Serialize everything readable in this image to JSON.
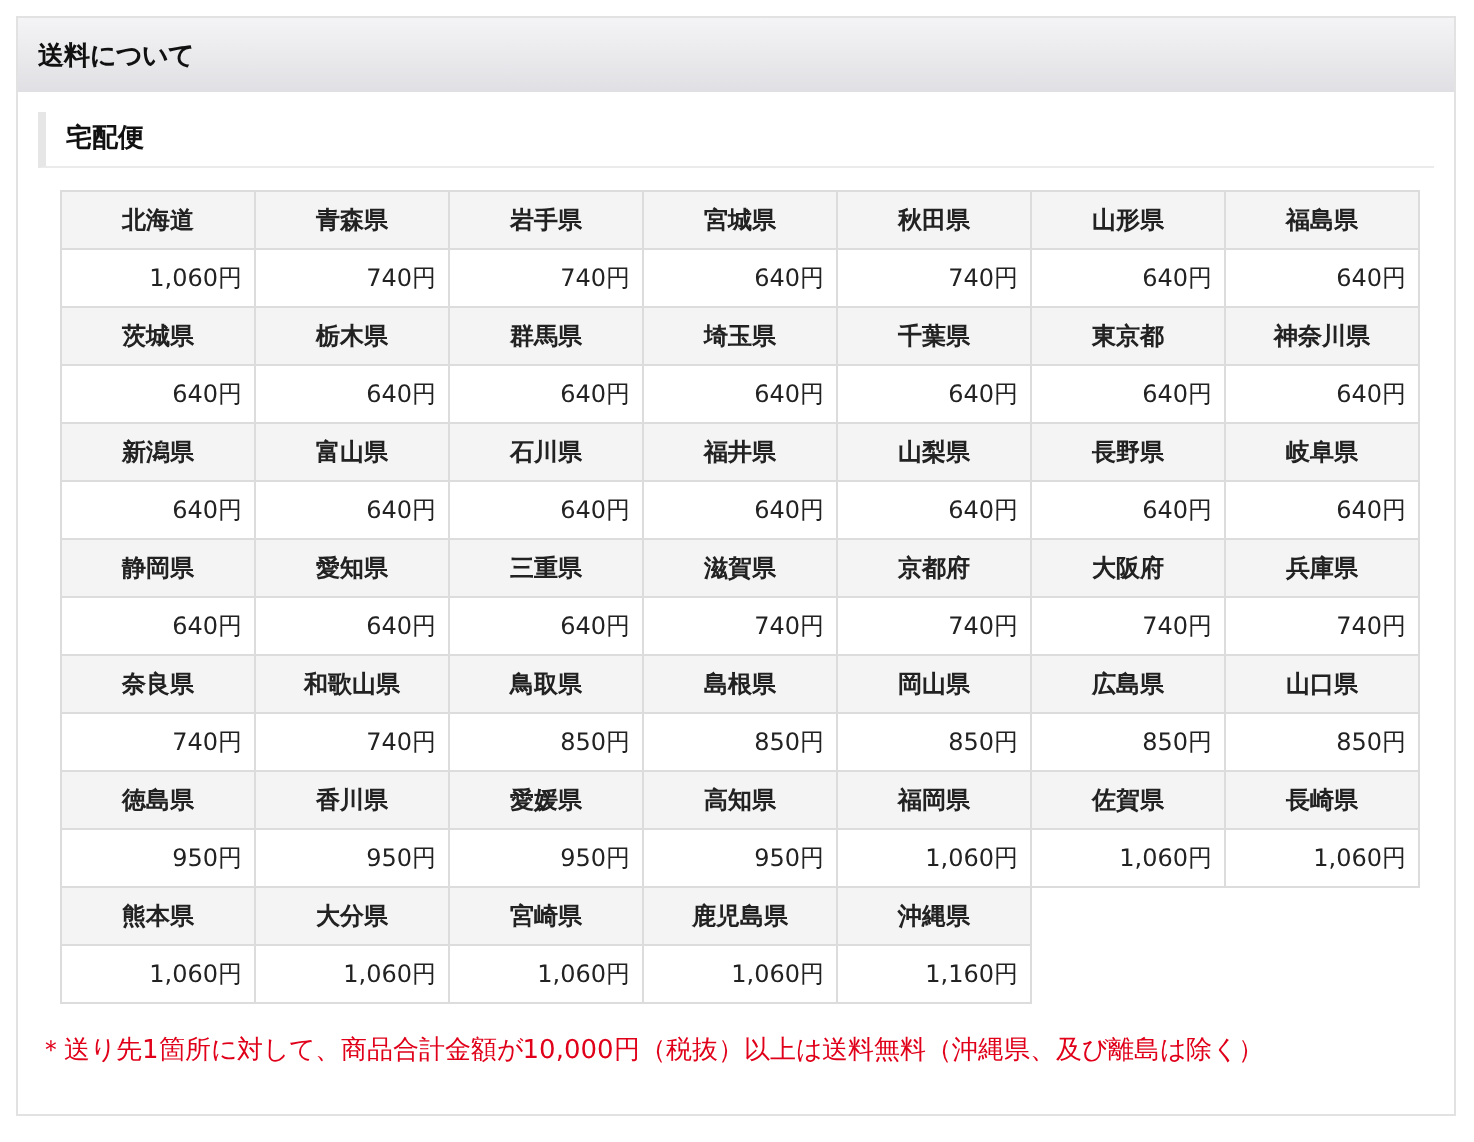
{
  "panel": {
    "title": "送料について",
    "subtitle": "宅配便"
  },
  "rates": [
    [
      {
        "region": "北海道",
        "price": "1,060円"
      },
      {
        "region": "青森県",
        "price": "740円"
      },
      {
        "region": "岩手県",
        "price": "740円"
      },
      {
        "region": "宮城県",
        "price": "640円"
      },
      {
        "region": "秋田県",
        "price": "740円"
      },
      {
        "region": "山形県",
        "price": "640円"
      },
      {
        "region": "福島県",
        "price": "640円"
      }
    ],
    [
      {
        "region": "茨城県",
        "price": "640円"
      },
      {
        "region": "栃木県",
        "price": "640円"
      },
      {
        "region": "群馬県",
        "price": "640円"
      },
      {
        "region": "埼玉県",
        "price": "640円"
      },
      {
        "region": "千葉県",
        "price": "640円"
      },
      {
        "region": "東京都",
        "price": "640円"
      },
      {
        "region": "神奈川県",
        "price": "640円"
      }
    ],
    [
      {
        "region": "新潟県",
        "price": "640円"
      },
      {
        "region": "富山県",
        "price": "640円"
      },
      {
        "region": "石川県",
        "price": "640円"
      },
      {
        "region": "福井県",
        "price": "640円"
      },
      {
        "region": "山梨県",
        "price": "640円"
      },
      {
        "region": "長野県",
        "price": "640円"
      },
      {
        "region": "岐阜県",
        "price": "640円"
      }
    ],
    [
      {
        "region": "静岡県",
        "price": "640円"
      },
      {
        "region": "愛知県",
        "price": "640円"
      },
      {
        "region": "三重県",
        "price": "640円"
      },
      {
        "region": "滋賀県",
        "price": "740円"
      },
      {
        "region": "京都府",
        "price": "740円"
      },
      {
        "region": "大阪府",
        "price": "740円"
      },
      {
        "region": "兵庫県",
        "price": "740円"
      }
    ],
    [
      {
        "region": "奈良県",
        "price": "740円"
      },
      {
        "region": "和歌山県",
        "price": "740円"
      },
      {
        "region": "鳥取県",
        "price": "850円"
      },
      {
        "region": "島根県",
        "price": "850円"
      },
      {
        "region": "岡山県",
        "price": "850円"
      },
      {
        "region": "広島県",
        "price": "850円"
      },
      {
        "region": "山口県",
        "price": "850円"
      }
    ],
    [
      {
        "region": "徳島県",
        "price": "950円"
      },
      {
        "region": "香川県",
        "price": "950円"
      },
      {
        "region": "愛媛県",
        "price": "950円"
      },
      {
        "region": "高知県",
        "price": "950円"
      },
      {
        "region": "福岡県",
        "price": "1,060円"
      },
      {
        "region": "佐賀県",
        "price": "1,060円"
      },
      {
        "region": "長崎県",
        "price": "1,060円"
      }
    ],
    [
      {
        "region": "熊本県",
        "price": "1,060円"
      },
      {
        "region": "大分県",
        "price": "1,060円"
      },
      {
        "region": "宮崎県",
        "price": "1,060円"
      },
      {
        "region": "鹿児島県",
        "price": "1,060円"
      },
      {
        "region": "沖縄県",
        "price": "1,160円"
      }
    ]
  ],
  "note": "＊送り先1箇所に対して、商品合計金額が10,000円（税抜）以上は送料無料（沖縄県、及び離島は除く）"
}
